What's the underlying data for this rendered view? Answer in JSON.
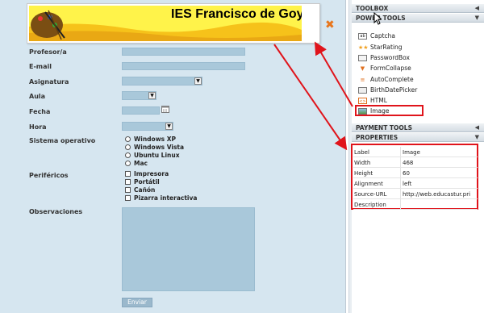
{
  "banner": {
    "title": "IES Francisco de Goya",
    "close_glyph": "✖"
  },
  "form": {
    "profesor_label": "Profesor/a",
    "email_label": "E-mail",
    "asignatura_label": "Asignatura",
    "aula_label": "Aula",
    "fecha_label": "Fecha",
    "hora_label": "Hora",
    "so_label": "Sistema operativo",
    "so_options": [
      "Windows XP",
      "Windows Vista",
      "Ubuntu Linux",
      "Mac"
    ],
    "perifericos_label": "Periféricos",
    "perifericos_options": [
      "Impresora",
      "Portátil",
      "Cañón",
      "Pizarra interactiva"
    ],
    "observaciones_label": "Observaciones",
    "submit_label": "Enviar"
  },
  "panel": {
    "toolbox_label": "TOOLBOX",
    "power_tools_label": "POWER TOOLS",
    "tools": [
      {
        "label": "Captcha",
        "icon": "captcha-icon"
      },
      {
        "label": "StarRating",
        "icon": "star-icon"
      },
      {
        "label": "PasswordBox",
        "icon": "password-icon"
      },
      {
        "label": "FormCollapse",
        "icon": "collapse-icon"
      },
      {
        "label": "AutoComplete",
        "icon": "autocomplete-icon"
      },
      {
        "label": "BirthDatePicker",
        "icon": "calendar-icon"
      },
      {
        "label": "HTML",
        "icon": "html-icon"
      },
      {
        "label": "Image",
        "icon": "image-icon"
      }
    ],
    "payment_tools_label": "PAYMENT TOOLS",
    "properties_label": "PROPERTIES",
    "properties": [
      {
        "key": "Label",
        "value": "Image"
      },
      {
        "key": "Width",
        "value": "468"
      },
      {
        "key": "Height",
        "value": "60"
      },
      {
        "key": "Alignment",
        "value": "left"
      },
      {
        "key": "Source-URL",
        "value": "http://web.educastur.pri"
      },
      {
        "key": "Description",
        "value": ""
      }
    ]
  },
  "colors": {
    "accent_red": "#e0141b",
    "form_bg": "#d6e6f0",
    "input_bg": "#a9c8da",
    "banner_yellow": "#fff34a"
  }
}
